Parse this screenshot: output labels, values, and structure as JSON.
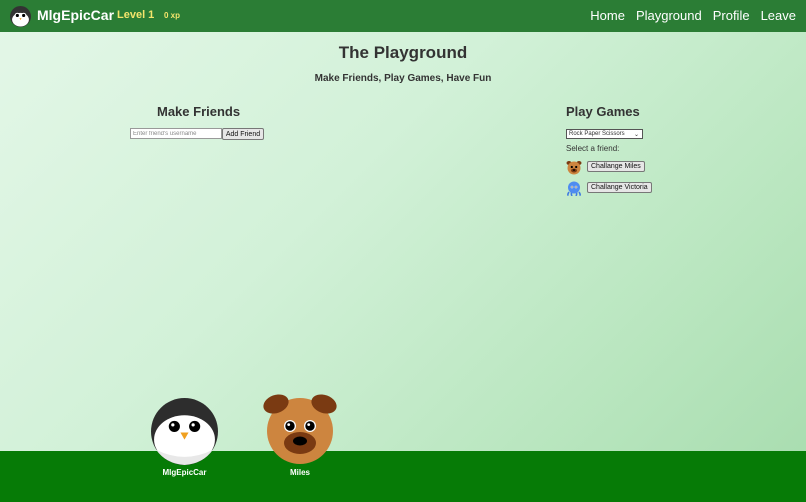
{
  "navbar": {
    "brand": "MlgEpicCar",
    "level": "Level 1",
    "xp": "0 xp",
    "links": [
      "Home",
      "Playground",
      "Profile",
      "Leave"
    ]
  },
  "page": {
    "title": "The Playground",
    "subtitle": "Make Friends, Play Games, Have Fun"
  },
  "make_friends": {
    "heading": "Make Friends",
    "input_placeholder": "Enter friend's username",
    "add_button": "Add Friend"
  },
  "play_games": {
    "heading": "Play Games",
    "selected_game": "Rock Paper Scissors",
    "select_label": "Select a friend:",
    "challenges": [
      {
        "button": "Challange Miles",
        "avatar": "dog-icon"
      },
      {
        "button": "Challange Victoria",
        "avatar": "octopus-icon"
      }
    ]
  },
  "characters": [
    {
      "name": "MlgEpicCar",
      "icon": "penguin-icon"
    },
    {
      "name": "Miles",
      "icon": "dog-icon"
    }
  ],
  "colors": {
    "navbar": "#2b7d35",
    "level_text": "#f4e56c",
    "ground": "#067b06"
  }
}
